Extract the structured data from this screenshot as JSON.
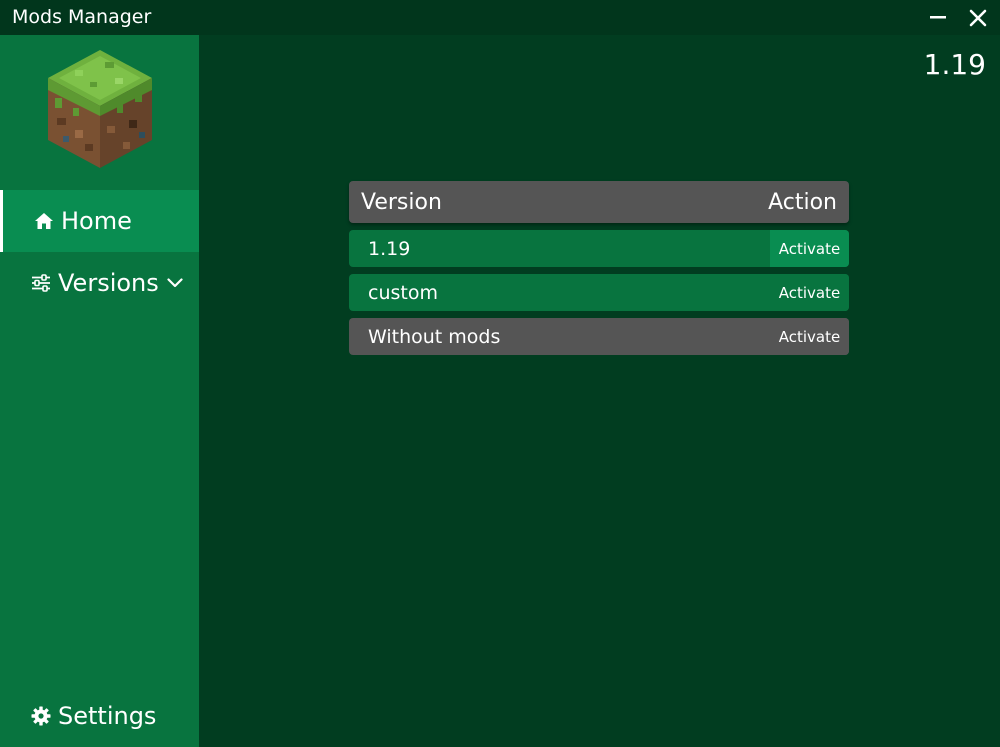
{
  "window": {
    "title": "Mods Manager",
    "minimize_label": "minimize",
    "close_label": "close"
  },
  "sidebar": {
    "logo_icon": "grass-block-icon",
    "items": [
      {
        "label": "Home",
        "icon": "home-icon",
        "active": true
      },
      {
        "label": "Versions",
        "icon": "sliders-icon",
        "expandable": true
      },
      {
        "label": "Settings",
        "icon": "gear-icon"
      }
    ]
  },
  "header": {
    "current_version": "1.19"
  },
  "table": {
    "columns": [
      "Version",
      "Action"
    ],
    "rows": [
      {
        "name": "1.19",
        "action": "Activate",
        "style": "green",
        "highlight": true
      },
      {
        "name": "custom",
        "action": "Activate",
        "style": "green"
      },
      {
        "name": "Without mods",
        "action": "Activate",
        "style": "gray"
      }
    ]
  },
  "colors": {
    "background": "#013d20",
    "titlebar": "#01361c",
    "sidebar": "#08743f",
    "active": "#098d51",
    "gray": "#555555"
  }
}
